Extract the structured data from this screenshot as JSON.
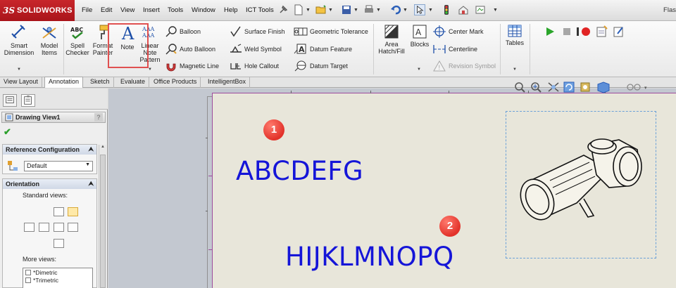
{
  "app": {
    "logo_ds": "3S",
    "logo_name": "SOLIDWORKS",
    "title_partial": "Flas"
  },
  "menu": [
    "File",
    "Edit",
    "View",
    "Insert",
    "Tools",
    "Window",
    "Help",
    "ICT Tools"
  ],
  "ribbon": {
    "smart_dimension": [
      "Smart",
      "Dimension"
    ],
    "model_items": [
      "Model",
      "Items"
    ],
    "spell_checker": [
      "Spell",
      "Checker"
    ],
    "format_painter": [
      "Format",
      "Painter"
    ],
    "note": "Note",
    "linear_note_pattern": [
      "Linear",
      "Note",
      "Pattern"
    ],
    "balloon": "Balloon",
    "auto_balloon": "Auto Balloon",
    "magnetic_line": "Magnetic Line",
    "surface_finish": "Surface Finish",
    "weld_symbol": "Weld Symbol",
    "hole_callout": "Hole Callout",
    "geometric_tolerance": "Geometric Tolerance",
    "datum_feature": "Datum Feature",
    "datum_target": "Datum Target",
    "area_hatch": [
      "Area",
      "Hatch/Fill"
    ],
    "blocks": "Blocks",
    "center_mark": "Center Mark",
    "centerline": "Centerline",
    "revision_symbol": "Revision Symbol",
    "tables": "Tables",
    "spell_icon_text": "ABC",
    "linear_icon_text": "AAA"
  },
  "tabs": [
    "View Layout",
    "Annotation",
    "Sketch",
    "Evaluate",
    "Office Products",
    "IntelligentBox"
  ],
  "property_manager": {
    "title": "Drawing View1",
    "help": "?",
    "reference_configuration": {
      "title": "Reference Configuration",
      "value": "Default"
    },
    "orientation": {
      "title": "Orientation",
      "standard_views_label": "Standard views:",
      "more_views_label": "More views:",
      "more_views": [
        "*Dimetric",
        "*Trimetric"
      ]
    }
  },
  "sheet": {
    "text1": "ABCDEFG",
    "text2": "HIJKLMNOPQ",
    "marker1": "1",
    "marker2": "2"
  },
  "colors": {
    "note_text": "#1515d8",
    "marker": "#e2322a",
    "highlight": "#e05050",
    "logo": "#b81c22"
  }
}
